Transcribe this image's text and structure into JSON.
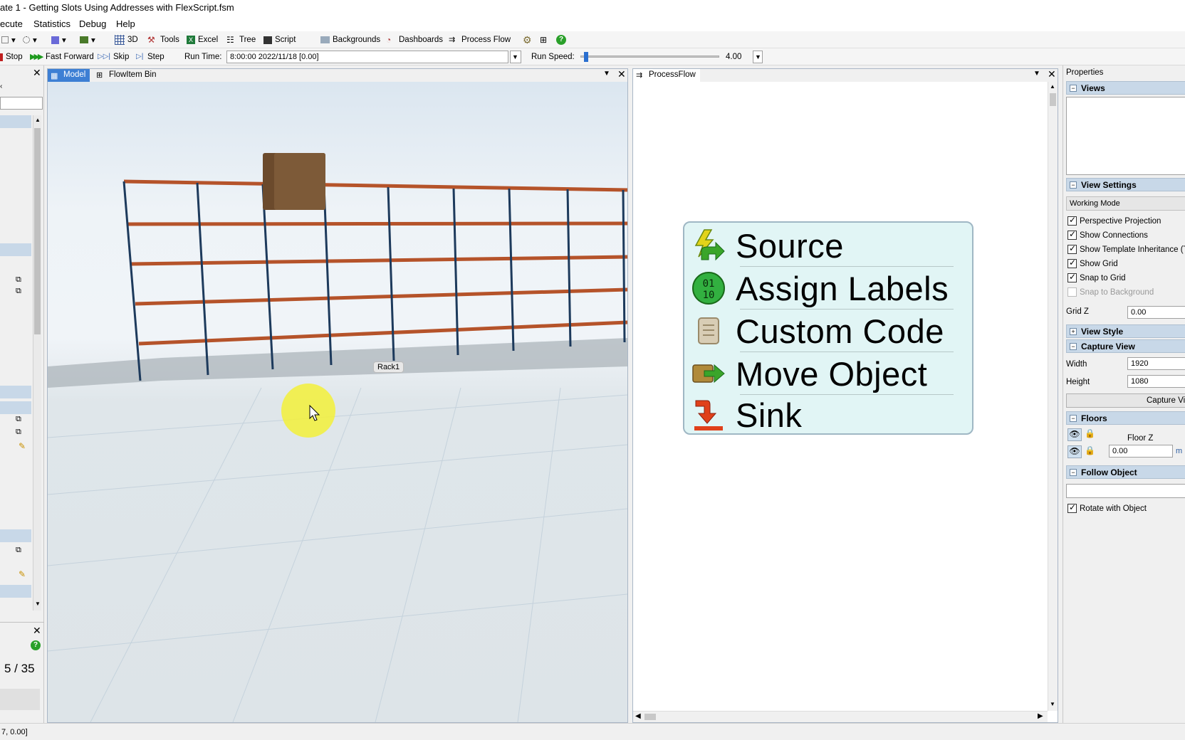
{
  "window": {
    "title": "ate 1 - Getting Slots Using Addresses with FlexScript.fsm"
  },
  "menu": {
    "items": [
      "ecute",
      "Statistics",
      "Debug",
      "Help"
    ]
  },
  "toolbar": {
    "view_3d": "3D",
    "tools": "Tools",
    "excel": "Excel",
    "tree": "Tree",
    "script": "Script",
    "backgrounds": "Backgrounds",
    "dashboards": "Dashboards",
    "process_flow": "Process Flow"
  },
  "runbar": {
    "stop": "Stop",
    "fast_forward": "Fast Forward",
    "skip": "Skip",
    "step": "Step",
    "run_time_label": "Run Time:",
    "run_time_value": "8:00:00  2022/11/18  [0.00]",
    "run_speed_label": "Run Speed:",
    "run_speed_value": "4.00",
    "run_speed_fraction": 0.02
  },
  "left_panel": {
    "page_counter": "5 / 35"
  },
  "model_view": {
    "tabs": [
      "Model",
      "FlowItem Bin"
    ],
    "rack_label": "Rack1"
  },
  "process_flow": {
    "tab": "ProcessFlow",
    "blocks": [
      {
        "label": "Source",
        "icon": "lightning-arrow-icon"
      },
      {
        "label": "Assign Labels",
        "icon": "binary-0110-icon"
      },
      {
        "label": "Custom Code",
        "icon": "scroll-icon"
      },
      {
        "label": "Move Object",
        "icon": "box-arrow-icon"
      },
      {
        "label": "Sink",
        "icon": "sink-arrow-icon"
      }
    ]
  },
  "properties": {
    "title": "Properties",
    "views_section": "Views",
    "view_settings_section": "View Settings",
    "working_mode": "Working Mode",
    "checkboxes": [
      {
        "label": "Perspective Projection",
        "checked": true
      },
      {
        "label": "Show Connections",
        "checked": true
      },
      {
        "label": "Show Template Inheritance (T)",
        "checked": true
      },
      {
        "label": "Show Grid",
        "checked": true
      },
      {
        "label": "Snap to Grid",
        "checked": true
      },
      {
        "label": "Snap to Background",
        "checked": false
      }
    ],
    "grid_z_label": "Grid Z",
    "grid_z_value": "0.00",
    "view_style_section": "View Style",
    "capture_view_section": "Capture View",
    "width_label": "Width",
    "width_value": "1920",
    "height_label": "Height",
    "height_value": "1080",
    "capture_button": "Capture Vie",
    "floors_section": "Floors",
    "floor_z_label": "Floor Z",
    "floor_z_value": "0.00",
    "floor_unit": "m",
    "follow_object_section": "Follow Object",
    "rotate_with_object": "Rotate with Object"
  },
  "status": {
    "text": "7, 0.00]"
  },
  "colors": {
    "accent": "#3d7fd4",
    "block_bg": "#e1f5f5",
    "shelf": "#b5532a",
    "upright": "#1d3a5c"
  }
}
